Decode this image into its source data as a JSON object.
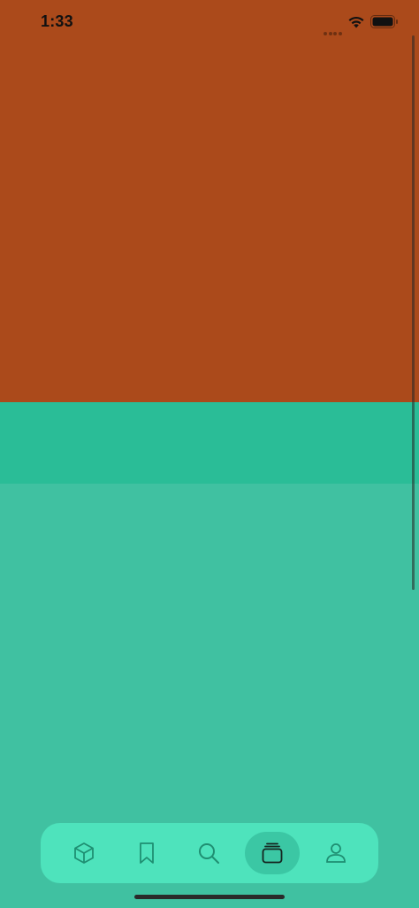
{
  "status_bar": {
    "time": "1:33"
  },
  "colors": {
    "top_section": "#ab4a1b",
    "mid_band": "#2abd97",
    "bottom_section": "#40c1a1",
    "tab_bar": "#4ee3bc",
    "tab_active": "#3bc7a4",
    "icon_stroke": "#1f8f72"
  },
  "tab_bar": {
    "tabs": [
      {
        "icon": "cube-icon",
        "active": false
      },
      {
        "icon": "bookmark-icon",
        "active": false
      },
      {
        "icon": "search-icon",
        "active": false
      },
      {
        "icon": "stack-icon",
        "active": true
      },
      {
        "icon": "person-icon",
        "active": false
      }
    ]
  }
}
